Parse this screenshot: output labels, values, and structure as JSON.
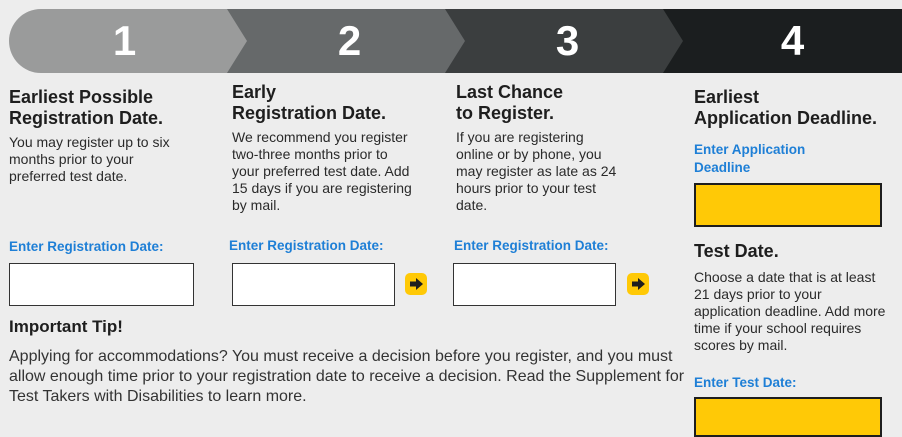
{
  "steps": [
    {
      "number": "1",
      "color": "#9a9b9b"
    },
    {
      "number": "2",
      "color": "#66696a"
    },
    {
      "number": "3",
      "color": "#3b3e3f"
    },
    {
      "number": "4",
      "color": "#1b1e1f"
    }
  ],
  "col1": {
    "heading_line1": "Earliest Possible",
    "heading_line2": "Registration Date.",
    "body": "You may register up to six months prior to your preferred test date.",
    "label": "Enter Registration Date:",
    "value": ""
  },
  "col2": {
    "heading_line1": "Early",
    "heading_line2": "Registration Date.",
    "body": "We recommend you register two-three months prior to your preferred test date. Add 15 days if you are registering by mail.",
    "label": "Enter Registration Date:",
    "value": ""
  },
  "col3": {
    "heading_line1": "Last Chance",
    "heading_line2": "to Register.",
    "body": "If you are registering online or by phone, you may register as late as 24 hours prior to your test date.",
    "label": "Enter Registration Date:",
    "value": ""
  },
  "col4": {
    "heading_line1": "Earliest",
    "heading_line2": "Application Deadline.",
    "label_line1": "Enter Application",
    "label_line2": "Deadline",
    "value": "",
    "test_heading": "Test Date.",
    "test_body": "Choose a date that is at least 21 days prior to your application deadline. Add more time if your school requires scores by mail.",
    "test_label": "Enter Test Date:",
    "test_value": ""
  },
  "tip": {
    "title": "Important Tip!",
    "body": "Applying for accommodations? You must receive a decision before you register, and you must allow enough time prior to your registration date to receive a decision. Read the Supplement for Test Takers with Disabilities to learn more."
  },
  "icons": {
    "next": "arrow-right-icon"
  },
  "colors": {
    "accent_blue": "#1e7fd6",
    "highlight_yellow": "#ffc906"
  }
}
